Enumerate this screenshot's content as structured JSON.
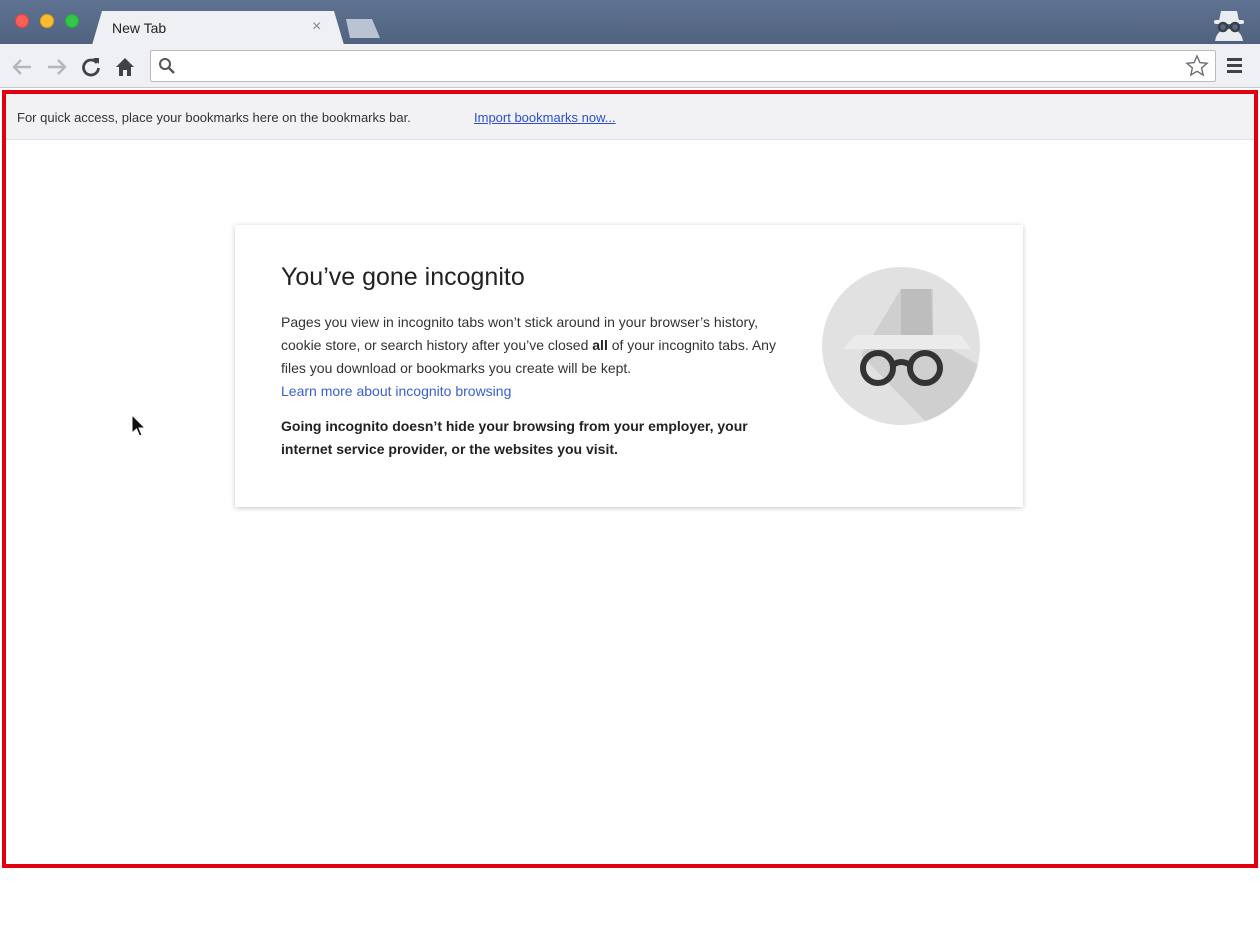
{
  "browser": {
    "tab_title": "New Tab",
    "tab_close_glyph": "×",
    "omnibox_value": "",
    "omnibox_placeholder": "",
    "icons": [
      "back-icon",
      "forward-icon",
      "reload-icon",
      "home-icon",
      "search-icon",
      "star-icon",
      "menu-icon",
      "incognito-avatar-icon"
    ]
  },
  "bookmarks_bar": {
    "hint": "For quick access, place your bookmarks here on the bookmarks bar.",
    "import_link": "Import bookmarks now..."
  },
  "incognito_card": {
    "title": "You’ve gone incognito",
    "desc_part1": "Pages you view in incognito tabs won’t stick around in your browser’s history, cookie store, or search history after you’ve closed ",
    "desc_bold": "all",
    "desc_part2": " of your incognito tabs. Any files you download or bookmarks you create will be kept.",
    "learn_more_link": "Learn more about incognito browsing",
    "warning": "Going incognito doesn’t hide your browsing from your employer, your internet service provider, or the websites you visit."
  },
  "colors": {
    "titlebar": "#55688a",
    "toolbar": "#eef0f4",
    "highlight_border": "#e1000f",
    "link": "#3a5fcd"
  }
}
